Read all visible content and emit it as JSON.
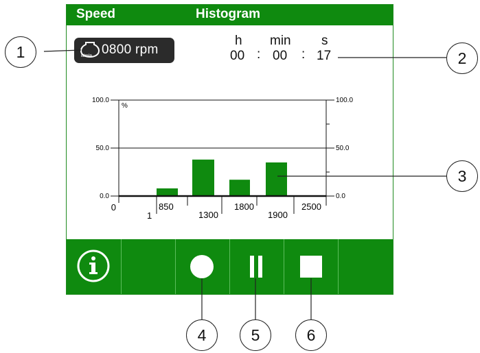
{
  "header": {
    "left_title": "Speed",
    "center_title": "Histogram"
  },
  "speed": {
    "value": "0800 rpm",
    "unit_label": "n/min",
    "icon": "motor-icon"
  },
  "time": {
    "hours_label": "h",
    "minutes_label": "min",
    "seconds_label": "s",
    "hours": "00",
    "minutes": "00",
    "seconds": "17",
    "separator": ":"
  },
  "chart_data": {
    "type": "bar",
    "unit": "%",
    "ylim": [
      0,
      100
    ],
    "left_ticks": [
      "100.0",
      "50.0",
      "0.0"
    ],
    "right_ticks": [
      "100.0",
      "50.0",
      "0.0"
    ],
    "x_tick_labels": [
      "0",
      "1",
      "850",
      "1300",
      "1800",
      "1900",
      "2500"
    ],
    "bars": [
      {
        "from": 850,
        "to": 1300,
        "value": 8
      },
      {
        "from": 1300,
        "to": 1800,
        "value": 38
      },
      {
        "from": 1800,
        "to": 1900,
        "value": 17
      },
      {
        "from": 1900,
        "to": 2500,
        "value": 35
      }
    ],
    "bar_color": "#0f8a0f"
  },
  "toolbar": {
    "buttons": [
      {
        "name": "info-button",
        "icon": "info-icon"
      },
      {
        "name": "empty-button",
        "icon": ""
      },
      {
        "name": "record-button",
        "icon": "record-icon"
      },
      {
        "name": "pause-button",
        "icon": "pause-icon"
      },
      {
        "name": "stop-button",
        "icon": "stop-icon"
      },
      {
        "name": "empty-button-2",
        "icon": ""
      }
    ]
  },
  "callouts": [
    "1",
    "2",
    "3",
    "4",
    "5",
    "6"
  ],
  "colors": {
    "accent": "#0f8a0f",
    "badge": "#2b2b2b"
  }
}
